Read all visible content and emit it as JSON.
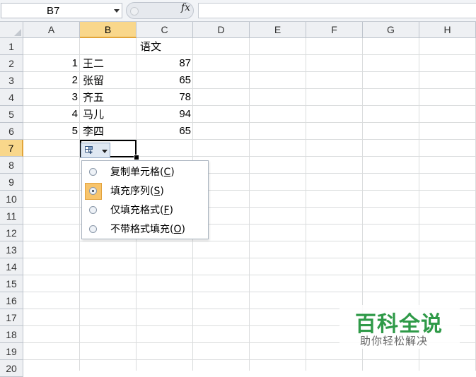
{
  "formula_bar": {
    "name_box": "B7",
    "fx": "fx",
    "formula": ""
  },
  "columns": [
    "A",
    "B",
    "C",
    "D",
    "E",
    "F",
    "G",
    "H"
  ],
  "rows": [
    "1",
    "2",
    "3",
    "4",
    "5",
    "6",
    "7",
    "8",
    "9",
    "10",
    "11",
    "12",
    "13",
    "14",
    "15",
    "16",
    "17",
    "18",
    "19",
    "20"
  ],
  "selected": {
    "column": "B",
    "row": "7"
  },
  "cells": {
    "C1": "语文",
    "A2": "1",
    "B2": "王二",
    "C2": "87",
    "A3": "2",
    "B3": "张留",
    "C3": "65",
    "A4": "3",
    "B4": "齐五",
    "C4": "78",
    "A5": "4",
    "B5": "马儿",
    "C5": "94",
    "A6": "5",
    "B6": "李四",
    "C6": "65"
  },
  "autofill_menu": {
    "items": [
      {
        "text": "复制单元格(",
        "key": "C",
        "close": ")",
        "selected": false
      },
      {
        "text": "填充序列(",
        "key": "S",
        "close": ")",
        "selected": true
      },
      {
        "text": "仅填充格式(",
        "key": "F",
        "close": ")",
        "selected": false
      },
      {
        "text": "不带格式填充(",
        "key": "O",
        "close": ")",
        "selected": false
      }
    ]
  },
  "watermark": {
    "title": "百科全说",
    "subtitle": "助你轻松解决"
  },
  "colors": {
    "header_selected": "#f9d78b",
    "menu_selected": "#f7c46c",
    "watermark_green": "#2f9a48"
  }
}
